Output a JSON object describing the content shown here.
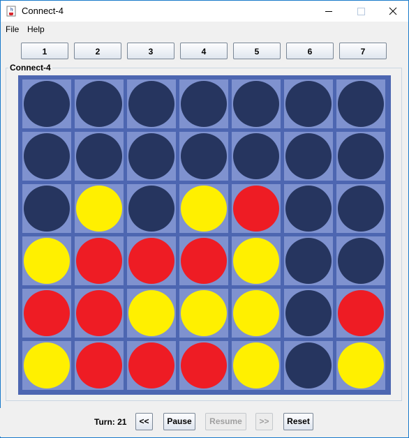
{
  "window": {
    "title": "Connect-4"
  },
  "menu": {
    "file": "File",
    "help": "Help"
  },
  "columns": [
    "1",
    "2",
    "3",
    "4",
    "5",
    "6",
    "7"
  ],
  "board": {
    "title": "Connect-4",
    "rows": [
      [
        "empty",
        "empty",
        "empty",
        "empty",
        "empty",
        "empty",
        "empty"
      ],
      [
        "empty",
        "empty",
        "empty",
        "empty",
        "empty",
        "empty",
        "empty"
      ],
      [
        "empty",
        "yellow",
        "empty",
        "yellow",
        "red",
        "empty",
        "empty"
      ],
      [
        "yellow",
        "red",
        "red",
        "red",
        "yellow",
        "empty",
        "empty"
      ],
      [
        "red",
        "red",
        "yellow",
        "yellow",
        "yellow",
        "empty",
        "red"
      ],
      [
        "yellow",
        "red",
        "red",
        "red",
        "yellow",
        "empty",
        "yellow"
      ]
    ]
  },
  "colors": {
    "empty": "#26355f",
    "yellow": "#fff000",
    "red": "#ee1c24"
  },
  "status": {
    "turn": "Turn: 21"
  },
  "controls": {
    "prev": "<<",
    "pause": "Pause",
    "resume": "Resume",
    "next": ">>",
    "reset": "Reset"
  }
}
